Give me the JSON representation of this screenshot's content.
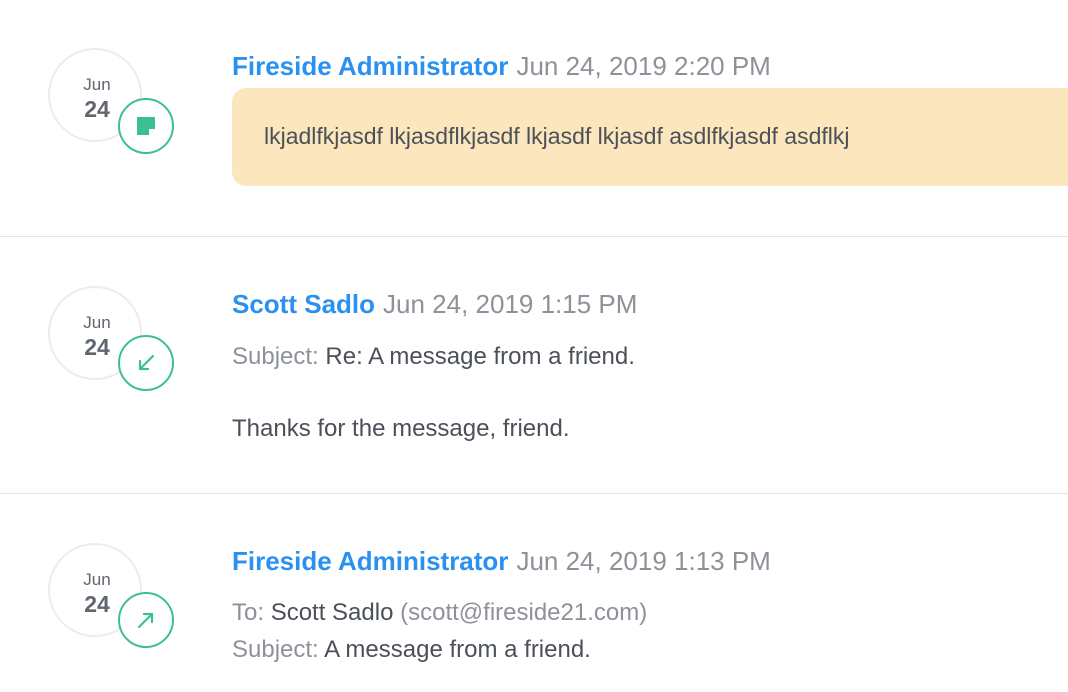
{
  "entries": [
    {
      "date_month": "Jun",
      "date_day": "24",
      "type_icon": "note-icon",
      "author": "Fireside Administrator",
      "timestamp": "Jun 24, 2019 2:20 PM",
      "note_text": "lkjadlfkjasdf lkjasdflkjasdf lkjasdf lkjasdf asdlfkjasdf asdflkj"
    },
    {
      "date_month": "Jun",
      "date_day": "24",
      "type_icon": "incoming-arrow-icon",
      "author": "Scott Sadlo",
      "timestamp": "Jun 24, 2019 1:15 PM",
      "subject_label": "Subject:",
      "subject_value": "Re: A message from a friend.",
      "body": "Thanks for the message, friend."
    },
    {
      "date_month": "Jun",
      "date_day": "24",
      "type_icon": "outgoing-arrow-icon",
      "author": "Fireside Administrator",
      "timestamp": "Jun 24, 2019 1:13 PM",
      "to_label": "To:",
      "to_name": "Scott Sadlo",
      "to_email": "(scott@fireside21.com)",
      "subject_label": "Subject:",
      "subject_value": "A message from a friend."
    }
  ],
  "colors": {
    "author": "#2b91f0",
    "icon_accent": "#3dbf95",
    "note_background": "#fbe6bd",
    "muted_text": "#8d9199",
    "body_text": "#4b5059"
  }
}
